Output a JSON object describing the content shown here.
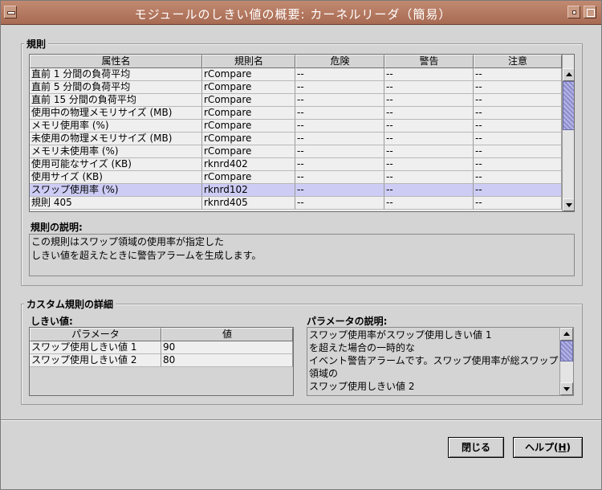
{
  "window": {
    "title": "モジュールのしきい値の概要: カーネルリーダ（簡易）"
  },
  "rules_group": {
    "legend": "規則",
    "columns": [
      "属性名",
      "規則名",
      "危険",
      "警告",
      "注意"
    ],
    "rows": [
      [
        "直前 1 分間の負荷平均",
        "rCompare",
        "--",
        "--",
        "--"
      ],
      [
        "直前 5 分間の負荷平均",
        "rCompare",
        "--",
        "--",
        "--"
      ],
      [
        "直前 15 分間の負荷平均",
        "rCompare",
        "--",
        "--",
        "--"
      ],
      [
        "使用中の物理メモリサイズ (MB)",
        "rCompare",
        "--",
        "--",
        "--"
      ],
      [
        "メモリ使用率 (%)",
        "rCompare",
        "--",
        "--",
        "--"
      ],
      [
        "未使用の物理メモリサイズ (MB)",
        "rCompare",
        "--",
        "--",
        "--"
      ],
      [
        "メモリ未使用率 (%)",
        "rCompare",
        "--",
        "--",
        "--"
      ],
      [
        "使用可能なサイズ (KB)",
        "rknrd402",
        "--",
        "--",
        "--"
      ],
      [
        "使用サイズ (KB)",
        "rCompare",
        "--",
        "--",
        "--"
      ],
      [
        "スワップ使用率 (%)",
        "rknrd102",
        "--",
        "--",
        "--"
      ],
      [
        "規則 405",
        "rknrd405",
        "--",
        "--",
        "--"
      ]
    ],
    "selected_row": 9,
    "description_label": "規則の説明:",
    "description_lines": [
      "この規則はスワップ領域の使用率が指定した",
      "しきい値を超えたときに警告アラームを生成します。"
    ]
  },
  "custom_group": {
    "legend": "カスタム規則の詳細",
    "thresholds_label": "しきい値:",
    "columns": [
      "パラメータ",
      "値"
    ],
    "rows": [
      [
        "スワップ使用しきい値 1",
        "90"
      ],
      [
        "スワップ使用しきい値 2",
        "80"
      ]
    ],
    "param_desc_label": "パラメータの説明:",
    "param_desc_lines": [
      "スワップ使用率がスワップ使用しきい値 1",
      "を超えた場合の一時的な",
      "イベント警告アラームです。スワップ使用率が総スワップ",
      "領域の",
      "スワップ使用しきい値 2"
    ]
  },
  "buttons": {
    "close": "閉じる",
    "help": "ヘルプ",
    "help_mnemonic": "H"
  },
  "colors": {
    "titlebar": "#b47a62",
    "selection": "#ccccf5",
    "scroll_thumb": "#9a9ad6"
  }
}
